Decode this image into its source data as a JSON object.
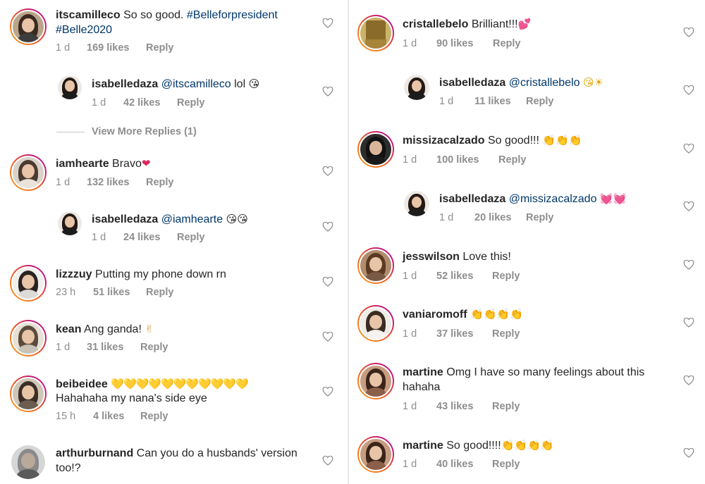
{
  "left": {
    "comments": [
      {
        "user": "itscamilleco",
        "text": "So so good. ",
        "mention": "#Belleforpresident",
        "line2_mention": "#Belle2020",
        "time": "1 d",
        "likes": "169 likes",
        "reply": "Reply"
      },
      {
        "user": "isabelledaza",
        "mention": "@itscamilleco",
        "text": " lol ",
        "emoji": "😘",
        "time": "1 d",
        "likes": "42 likes",
        "reply": "Reply"
      },
      {
        "user": "iamhearte",
        "text": "Bravo",
        "emoji": "❤",
        "time": "1 d",
        "likes": "132 likes",
        "reply": "Reply"
      },
      {
        "user": "isabelledaza",
        "mention": "@iamhearte",
        "text": " ",
        "emoji": "😘😘",
        "time": "1 d",
        "likes": "24 likes",
        "reply": "Reply"
      },
      {
        "user": "lizzzuy",
        "text": "Putting my phone down rn",
        "time": "23 h",
        "likes": "51 likes",
        "reply": "Reply"
      },
      {
        "user": "kean",
        "text": "Ang ganda! ",
        "emoji": "✌",
        "time": "1 d",
        "likes": "31 likes",
        "reply": "Reply"
      },
      {
        "user": "beibeidee",
        "text": " ",
        "emoji": "💛💛💛💛💛💛💛💛💛💛💛",
        "line2": "Hahahaha my nana's side eye",
        "time": "15 h",
        "likes": "4 likes",
        "reply": "Reply"
      },
      {
        "user": "arthurburnand",
        "text": "Can you do a husbands' version",
        "line2": "too!?"
      }
    ],
    "view_more": "View More Replies (1)"
  },
  "right": {
    "comments": [
      {
        "user": "cristallebelo",
        "text": "Brilliant!!!",
        "emoji": "💕",
        "time": "1 d",
        "likes": "90 likes",
        "reply": "Reply"
      },
      {
        "user": "isabelledaza",
        "mention": "@cristallebelo",
        "text": " ",
        "emoji": "😘☀",
        "time": "1 d",
        "likes": "11 likes",
        "reply": "Reply"
      },
      {
        "user": "missizacalzado",
        "text": "So good!!! ",
        "emoji": "👏👏👏",
        "time": "1 d",
        "likes": "100 likes",
        "reply": "Reply"
      },
      {
        "user": "isabelledaza",
        "mention": "@missizacalzado",
        "text": " ",
        "emoji": "💓💓",
        "time": "1 d",
        "likes": "20 likes",
        "reply": "Reply"
      },
      {
        "user": "jesswilson",
        "text": "Love this!",
        "time": "1 d",
        "likes": "52 likes",
        "reply": "Reply"
      },
      {
        "user": "vaniaromoff",
        "text": " ",
        "emoji": "👏👏👏👏",
        "time": "1 d",
        "likes": "37 likes",
        "reply": "Reply"
      },
      {
        "user": "martine",
        "text": "Omg I have so many feelings about this",
        "line2": "hahaha",
        "time": "1 d",
        "likes": "43 likes",
        "reply": "Reply"
      },
      {
        "user": "martine",
        "text": "So good!!!!",
        "emoji": "👏👏👏👏",
        "time": "1 d",
        "likes": "40 likes",
        "reply": "Reply"
      }
    ]
  },
  "colors": {
    "username": "#262626",
    "mention": "#00376b",
    "meta": "#8e8e8e",
    "ring_start": "#f9a825",
    "ring_end": "#c1167a"
  },
  "icons": {
    "like": "heart-outline-icon"
  }
}
